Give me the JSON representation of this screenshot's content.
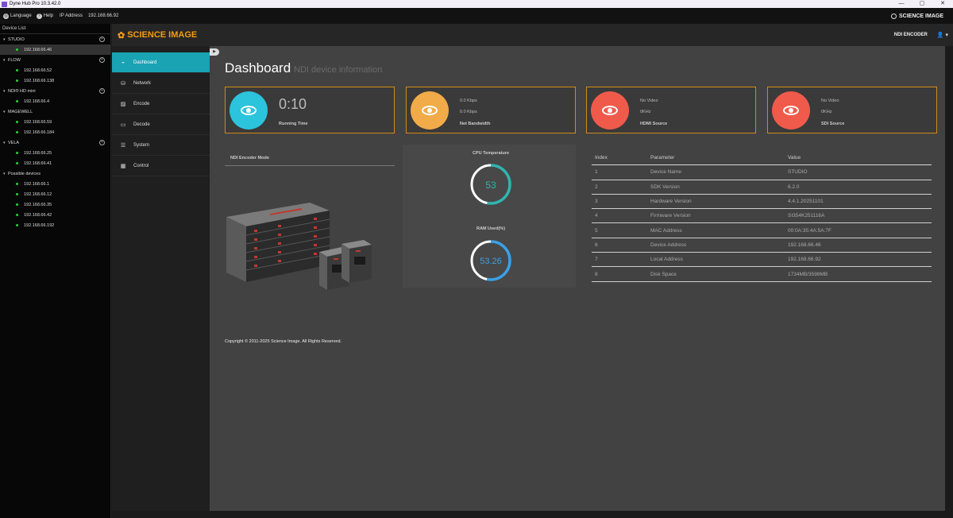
{
  "window": {
    "title": "Dyne Hub Pro 10.3.42.0",
    "controls": [
      "—",
      "▢",
      "✕"
    ]
  },
  "menubar": {
    "language": "Language",
    "help": "Help",
    "ip_label": "IP Address",
    "ip_value": "192.168.66.92",
    "brand": "SCIENCE IMAGE"
  },
  "device_list": {
    "header": "Device List",
    "groups": [
      {
        "name": "STUDIO",
        "devices": [
          "192.168.66.46"
        ]
      },
      {
        "name": "FLOW",
        "devices": [
          "192.168.66.52",
          "192.168.66.138"
        ]
      },
      {
        "name": "NDI® HD mini",
        "devices": [
          "192.168.66.4"
        ]
      },
      {
        "name": "MAGEWELL",
        "devices": [
          "192.168.66.59",
          "192.168.66.184"
        ]
      },
      {
        "name": "VELA",
        "devices": [
          "192.168.66.25",
          "192.168.66.41"
        ]
      },
      {
        "name": "Possible devices",
        "devices": [
          "192.168.66.1",
          "192.168.66.12",
          "192.168.66.35",
          "192.168.66.42",
          "192.168.66.192"
        ]
      }
    ]
  },
  "app_header": {
    "logo": "SCIENCE IMAGE",
    "mode": "NDI ENCODER"
  },
  "nav": [
    {
      "label": "Dashboard",
      "icon": "dashboard-icon"
    },
    {
      "label": "Network",
      "icon": "network-icon"
    },
    {
      "label": "Encode",
      "icon": "encode-icon"
    },
    {
      "label": "Decode",
      "icon": "decode-icon"
    },
    {
      "label": "System",
      "icon": "system-icon"
    },
    {
      "label": "Control",
      "icon": "control-icon"
    }
  ],
  "page": {
    "title": "Dashboard",
    "subtitle": "NDI device information"
  },
  "cards": {
    "running": {
      "value": "0:10",
      "label": "Running Time"
    },
    "bandwidth": {
      "line1": "0.0 Kbps",
      "line2": "0.0 Kbps",
      "label": "Net Bandwidth"
    },
    "hdmi": {
      "line1": "No Video",
      "line2": "0KHz",
      "label": "HDMI Source"
    },
    "sdi": {
      "line1": "No Video",
      "line2": "0KHz",
      "label": "SDI Source"
    }
  },
  "mode_panel": {
    "title": "NDI Encoder Mode"
  },
  "gauges": {
    "cpu": {
      "title": "CPU Temperature",
      "value": "53",
      "fraction": 0.53,
      "color": "#2fb5ad"
    },
    "ram": {
      "title": "RAM Used(%)",
      "value": "53.26",
      "fraction": 0.5326,
      "color": "#3aa0e6"
    }
  },
  "table": {
    "headers": [
      "Index",
      "Parameter",
      "Value"
    ],
    "rows": [
      [
        "1",
        "Device Name",
        "STUDIO"
      ],
      [
        "2",
        "SDK Version",
        "6.2.0"
      ],
      [
        "3",
        "Hardware Version",
        "4.4.1.20251101"
      ],
      [
        "4",
        "Firmware Version",
        "SI354K251116A"
      ],
      [
        "5",
        "MAC Address",
        "00:0A:35:4A:5A:7F"
      ],
      [
        "6",
        "Device Address",
        "192.168.66.46"
      ],
      [
        "7",
        "Local Address",
        "192.168.66.92"
      ],
      [
        "8",
        "Disk Space",
        "1734MB/3598MB"
      ]
    ]
  },
  "copyright": "Copyright © 2011-2025 Science Image. All Rights Reserved.",
  "colors": {
    "accent": "#1aa3b3",
    "orange_border": "#d38b14",
    "logo": "#f39c12"
  }
}
